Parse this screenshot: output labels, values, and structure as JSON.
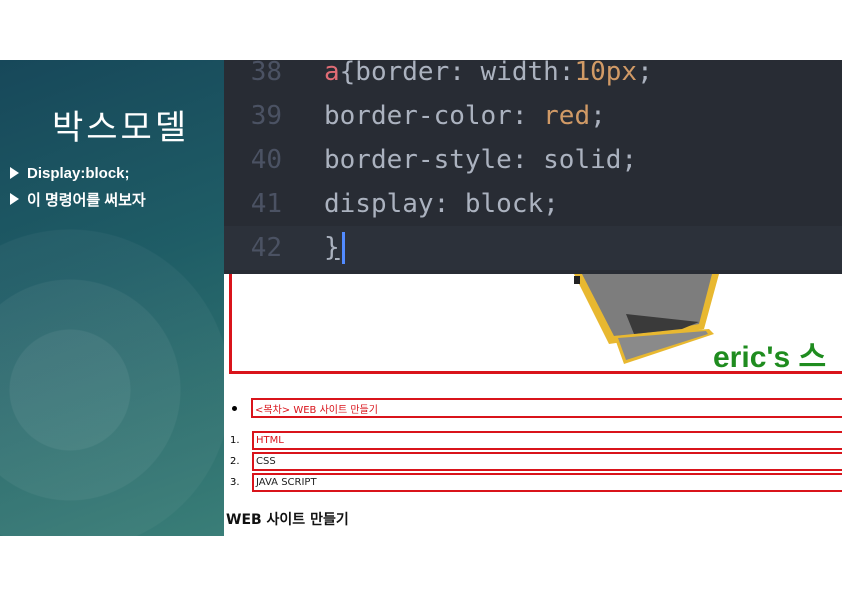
{
  "slide": {
    "title": "박스모델",
    "bullets": [
      "Display:block;",
      "이 명령어를 써보자"
    ]
  },
  "editor": {
    "lines": [
      {
        "num": "38",
        "sel": "a",
        "rest": "{border: width:",
        "num_val": "10px",
        "end": ";"
      },
      {
        "num": "39",
        "text_pre": "border-color: ",
        "val": "red",
        "end": ";"
      },
      {
        "num": "40",
        "text": "border-style: solid;"
      },
      {
        "num": "41",
        "text": "display: block;"
      },
      {
        "num": "42",
        "text": "}"
      }
    ]
  },
  "webpage": {
    "banner_text": "eric's 스",
    "nav_link": "<목차> WEB 사이트 만들기",
    "list": [
      {
        "num": "1.",
        "label": "HTML"
      },
      {
        "num": "2.",
        "label": "CSS"
      },
      {
        "num": "3.",
        "label": "JAVA SCRIPT"
      }
    ],
    "heading": "WEB 사이트 만들기"
  },
  "colors": {
    "panel": "#1f5d66",
    "editor_bg": "#282c34",
    "link_red": "#d9141b",
    "banner_green": "#1f8c1f"
  }
}
